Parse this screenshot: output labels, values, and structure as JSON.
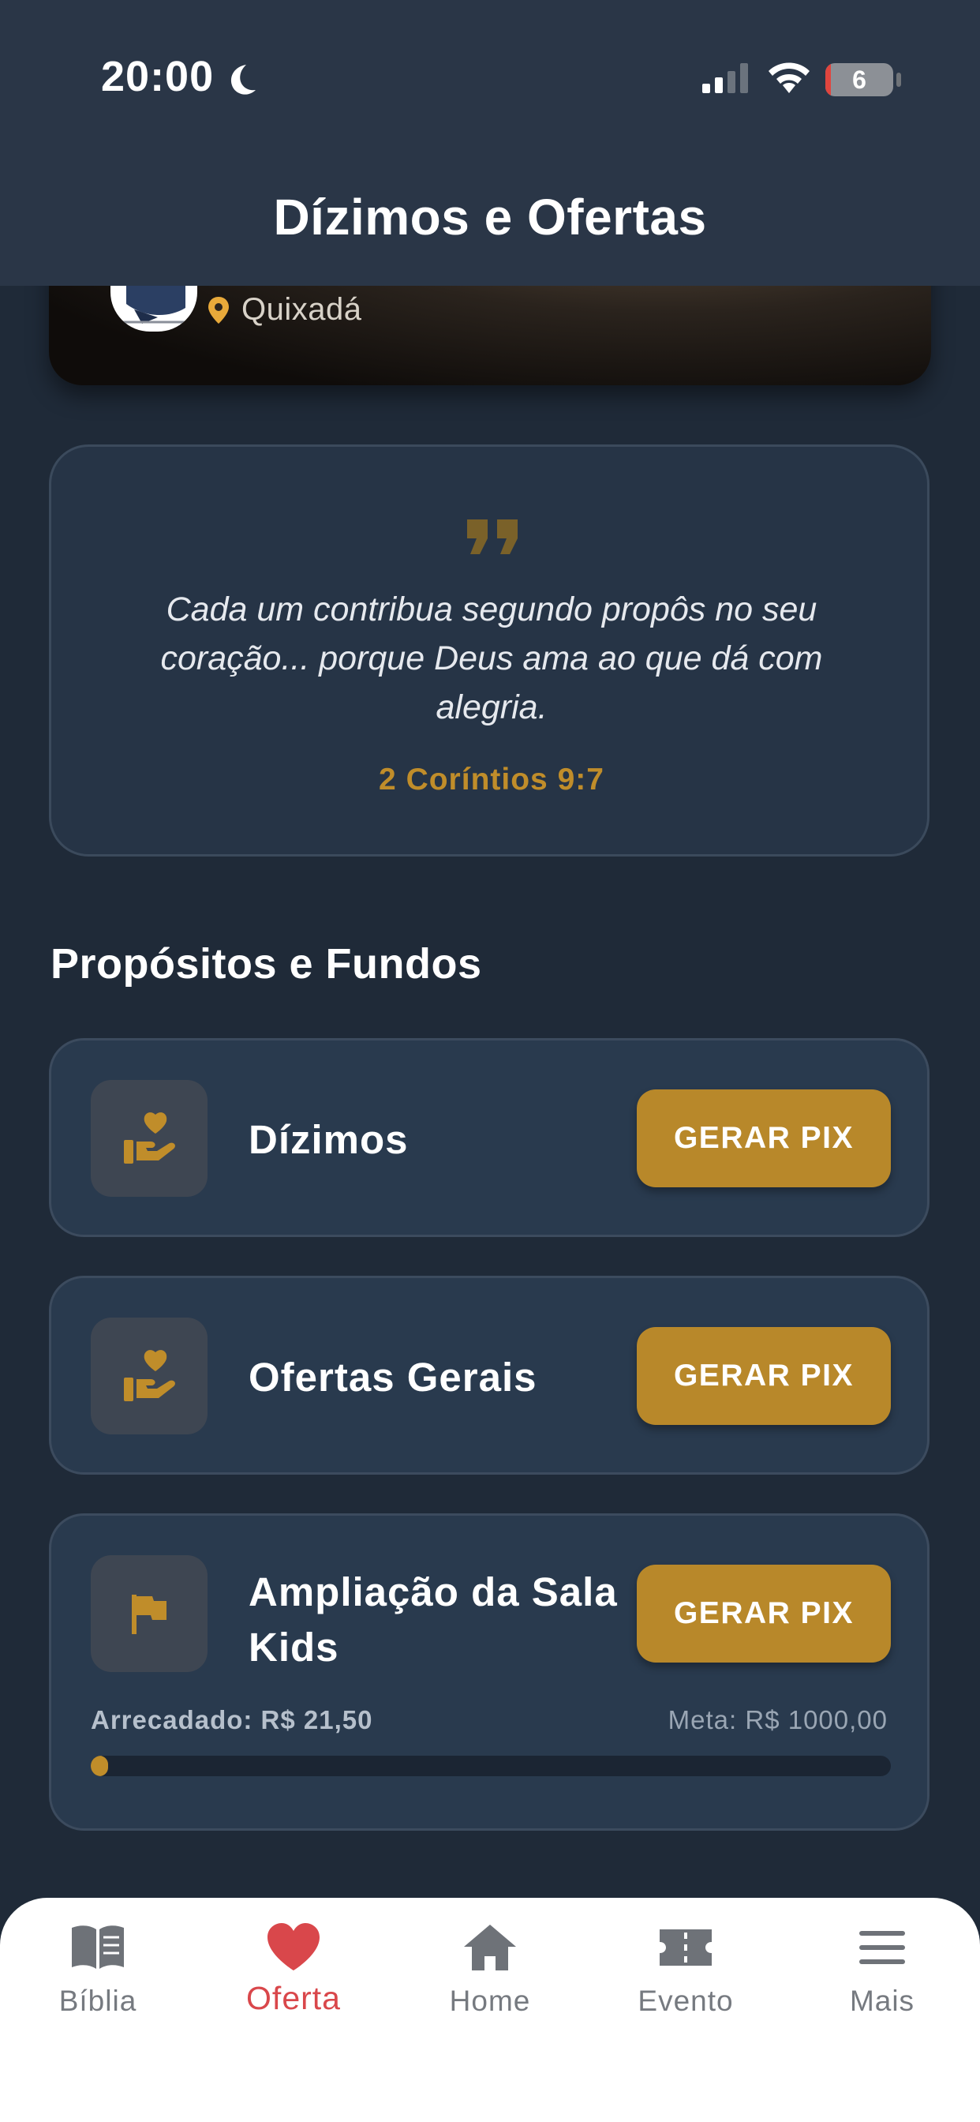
{
  "status_bar": {
    "time": "20:00",
    "battery": "6",
    "battery_level": 0.06
  },
  "header": {
    "title": "Dízimos e Ofertas"
  },
  "hero": {
    "location": "Quixadá"
  },
  "verse": {
    "text": "Cada um contribua segundo propôs no seu coração... porque Deus ama ao que dá com alegria.",
    "reference": "2 Coríntios 9:7"
  },
  "funds_section": {
    "title": "Propósitos e Fundos",
    "items": [
      {
        "name": "Dízimos",
        "button": "GERAR PIX",
        "icon": "heart-hand-icon"
      },
      {
        "name": "Ofertas Gerais",
        "button": "GERAR PIX",
        "icon": "heart-hand-icon"
      },
      {
        "name": "Ampliação da Sala Kids",
        "button": "GERAR PIX",
        "icon": "flag-icon",
        "raised_label": "Arrecadado: R$ 21,50",
        "goal_label": "Meta: R$ 1000,00",
        "progress": 0.0215
      }
    ]
  },
  "tab_bar": {
    "items": [
      {
        "label": "Bíblia",
        "icon": "bible-icon"
      },
      {
        "label": "Oferta",
        "icon": "heart-icon",
        "active": true
      },
      {
        "label": "Home",
        "icon": "home-icon"
      },
      {
        "label": "Evento",
        "icon": "ticket-icon"
      },
      {
        "label": "Mais",
        "icon": "menu-icon"
      }
    ]
  },
  "colors": {
    "accent": "#B8882A",
    "background": "#1F2A38",
    "card": "#293A4E",
    "active_tab": "#D9474B"
  }
}
